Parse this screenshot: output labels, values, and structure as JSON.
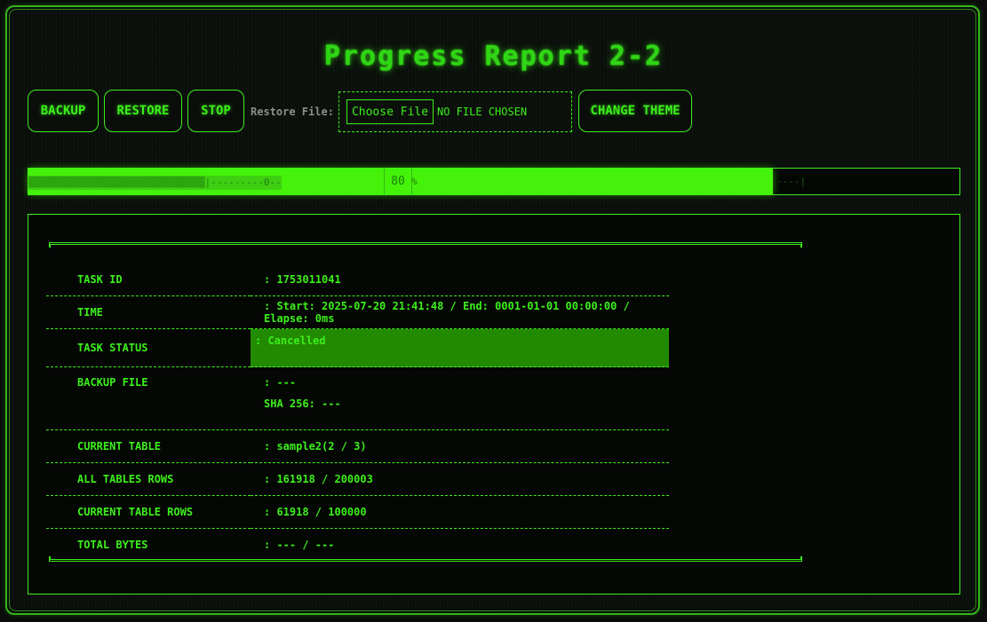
{
  "title": "Progress Report 2-2",
  "toolbar": {
    "backup_label": "BACKUP",
    "restore_label": "RESTORE",
    "stop_label": "STOP",
    "restore_file_label": "Restore File:",
    "choose_file_label": "Choose File",
    "file_status": "NO FILE CHOSEN",
    "change_theme_label": "CHANGE THEME"
  },
  "progress": {
    "percent": 80,
    "percent_text": "80",
    "percent_sign": "%",
    "ascii_bar": "▒▒▒▒▒▒▒▒▒▒▒▒▒▒▒▒▒▒▒▒▒▒▒▒▒▒▒▒▒▒|---------0-----",
    "tail": "----|"
  },
  "info": {
    "rows": [
      {
        "label": "TASK ID",
        "value": ": 1753011041"
      },
      {
        "label": "TIME",
        "value": ": Start: 2025-07-20 21:41:48 / End: 0001-01-01 00:00:00 / Elapse: 0ms"
      },
      {
        "label": "TASK STATUS",
        "value": ": Cancelled"
      },
      {
        "label": "BACKUP FILE",
        "value": ": ---",
        "sub": "SHA 256: ---"
      },
      {
        "label": "CURRENT TABLE",
        "value": ": sample2(2 / 3)"
      },
      {
        "label": "ALL TABLES ROWS",
        "value": ": 161918 / 200003"
      },
      {
        "label": "CURRENT TABLE ROWS",
        "value": ": 61918 / 100000"
      },
      {
        "label": "TOTAL BYTES",
        "value": ": --- / ---"
      }
    ]
  },
  "colors": {
    "accent": "#3cf01a",
    "progress_fill": "#44f20a",
    "status_bg": "#228a00",
    "background": "#0a0d0a"
  }
}
